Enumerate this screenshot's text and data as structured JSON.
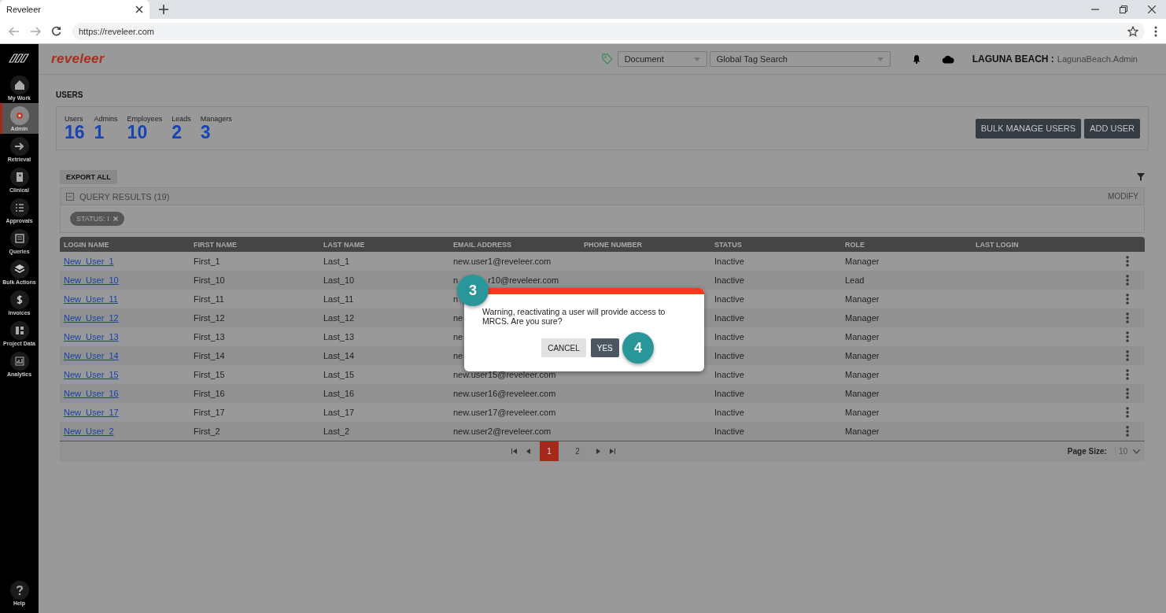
{
  "browser": {
    "tab_title": "Reveleer",
    "url": "https://reveleer.com"
  },
  "header": {
    "logo": "reveleer",
    "document_select": "Document",
    "tag_search": "Global Tag Search",
    "org": "LAGUNA BEACH :",
    "user": "LagunaBeach.Admin"
  },
  "sidebar": {
    "items": [
      {
        "label": "My Work",
        "selected": false
      },
      {
        "label": "Admin",
        "selected": true
      },
      {
        "label": "Retrieval",
        "selected": false
      },
      {
        "label": "Clinical",
        "selected": false
      },
      {
        "label": "Approvals",
        "selected": false
      },
      {
        "label": "Queries",
        "selected": false
      },
      {
        "label": "Bulk Actions",
        "selected": false
      },
      {
        "label": "Invoices",
        "selected": false
      },
      {
        "label": "Project Data",
        "selected": false
      },
      {
        "label": "Analytics",
        "selected": false
      }
    ],
    "help": "Help"
  },
  "page_title": "USERS",
  "stats": [
    {
      "label": "Users",
      "value": "16"
    },
    {
      "label": "Admins",
      "value": "1"
    },
    {
      "label": "Employees",
      "value": "10"
    },
    {
      "label": "Leads",
      "value": "2"
    },
    {
      "label": "Managers",
      "value": "3"
    }
  ],
  "actions": [
    "BULK MANAGE USERS",
    "ADD USER"
  ],
  "export_button": "EXPORT ALL",
  "query": {
    "title": "QUERY RESULTS (19)",
    "modify": "MODIFY",
    "filters": [
      "STATUS: I"
    ]
  },
  "table": {
    "columns": [
      "LOGIN NAME",
      "FIRST NAME",
      "LAST NAME",
      "EMAIL ADDRESS",
      "PHONE NUMBER",
      "STATUS",
      "ROLE",
      "LAST LOGIN"
    ],
    "rows": [
      {
        "login": "New_User_1",
        "first": "First_1",
        "last": "Last_1",
        "email": "new.user1@reveleer.com",
        "status": "Inactive",
        "role": "Manager"
      },
      {
        "login": "New_User_10",
        "first": "First_10",
        "last": "Last_10",
        "email": "n",
        "email_tail": "r10@reveleer.com",
        "status": "Inactive",
        "role": "Lead"
      },
      {
        "login": "New_User_11",
        "first": "First_11",
        "last": "Last_11",
        "email": "n",
        "status": "Inactive",
        "role": "Manager"
      },
      {
        "login": "New_User_12",
        "first": "First_12",
        "last": "Last_12",
        "email": "ne",
        "status": "Inactive",
        "role": "Manager"
      },
      {
        "login": "New_User_13",
        "first": "First_13",
        "last": "Last_13",
        "email": "ne",
        "status": "Inactive",
        "role": "Manager"
      },
      {
        "login": "New_User_14",
        "first": "First_14",
        "last": "Last_14",
        "email": "ne",
        "status": "Inactive",
        "role": "Manager"
      },
      {
        "login": "New_User_15",
        "first": "First_15",
        "last": "Last_15",
        "email": "new.user15@reveleer.com",
        "status": "Inactive",
        "role": "Manager"
      },
      {
        "login": "New_User_16",
        "first": "First_16",
        "last": "Last_16",
        "email": "new.user16@reveleer.com",
        "status": "Inactive",
        "role": "Manager"
      },
      {
        "login": "New_User_17",
        "first": "First_17",
        "last": "Last_17",
        "email": "new.user17@reveleer.com",
        "status": "Inactive",
        "role": "Manager"
      },
      {
        "login": "New_User_2",
        "first": "First_2",
        "last": "Last_2",
        "email": "new.user2@reveleer.com",
        "status": "Inactive",
        "role": "Manager"
      }
    ]
  },
  "pagination": {
    "pages": [
      {
        "label": "1",
        "selected": true
      },
      {
        "label": "2",
        "selected": false
      }
    ],
    "page_size_label": "Page Size:",
    "page_size": "10"
  },
  "dialog": {
    "message": "Warning, reactivating a user will provide access to MRCS. Are you sure?",
    "buttons": [
      {
        "label": "CANCEL",
        "kind": "secondary"
      },
      {
        "label": "YES",
        "kind": "primary"
      }
    ]
  },
  "callouts": [
    "3",
    "4"
  ]
}
